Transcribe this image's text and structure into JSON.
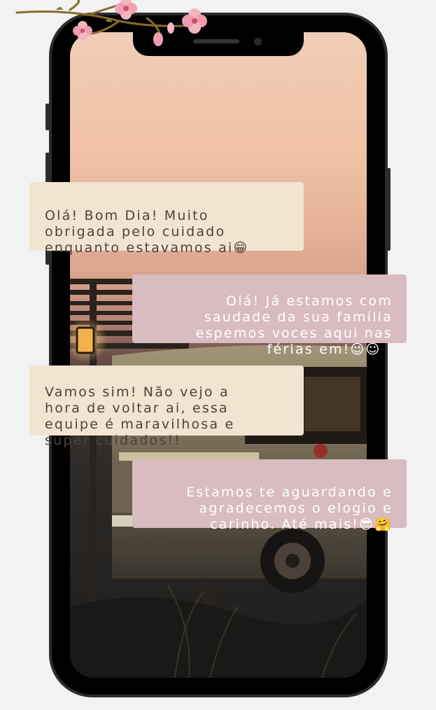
{
  "messages": [
    {
      "id": "m1",
      "side": "received",
      "text": "Olá! Bom Dia! Muito\nobrigada pelo cuidado\nenquanto estavamos ai",
      "emoji": "😁"
    },
    {
      "id": "m2",
      "side": "sent",
      "text": "Olá! Já estamos com\nsaudade da sua família\nespemos voces aqui nas\nférias em!",
      "emoji": "😉☺ ."
    },
    {
      "id": "m3",
      "side": "received",
      "text": "Vamos sim! Não vejo a\nhora de voltar ai, essa\nequipe é maravilhosa e\nsuper cuidados!!",
      "emoji": ""
    },
    {
      "id": "m4",
      "side": "sent",
      "text": "Estamos te aguardando e\nagradecemos o elogio e\ncarinho. Até mais!",
      "emoji": "😎🤗"
    }
  ],
  "colors": {
    "received_bubble": "#f1e5d2",
    "sent_bubble": "#d8bcc0",
    "received_text": "#4e4138",
    "sent_text": "#ffffff"
  },
  "decorations": {
    "branch": "cherry-blossom-branch",
    "scene": "vintage-bus-at-sunset"
  }
}
